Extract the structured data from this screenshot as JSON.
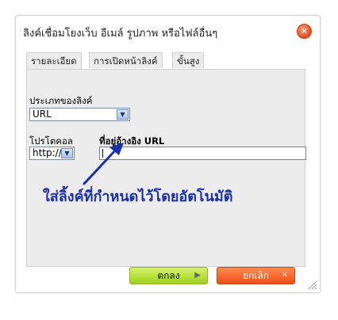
{
  "dialog": {
    "title": "ลิงค์เชื่อมโยงเว็บ อีเมล์ รูปภาพ หรือไฟล์อื่นๆ",
    "close_icon": "close-icon"
  },
  "tabs": [
    {
      "label": "รายละเอียด",
      "active": true
    },
    {
      "label": "การเปิดหน้าลิงค์",
      "active": false
    },
    {
      "label": "ขั้นสูง",
      "active": false
    }
  ],
  "form": {
    "link_type_label": "ประเภทของลิงค์",
    "link_type_value": "URL",
    "protocol_label": "โปรโตคอล",
    "protocol_value": "http://",
    "url_label": "ที่อยู่อ้างอิง URL",
    "url_value": ""
  },
  "annotation": {
    "text": "ใส่ลิ้งค์ที่กำหนดไว้โดยอัตโนมัติ",
    "color": "#1a2fb0"
  },
  "buttons": {
    "ok_label": "ตกลง",
    "cancel_label": "ยกเลิก"
  },
  "colors": {
    "ok_button": "#9fd21c",
    "cancel_button": "#f04d16",
    "close_button": "#f05a2e"
  }
}
